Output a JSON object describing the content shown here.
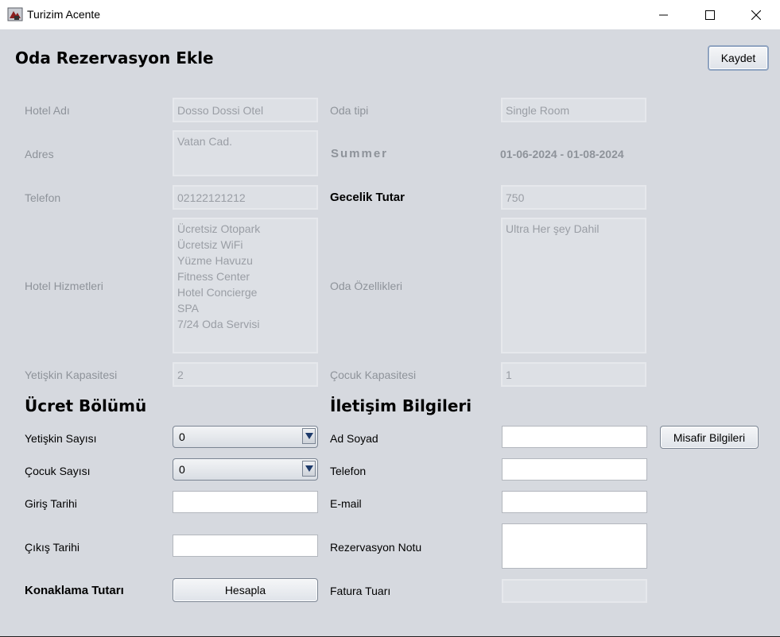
{
  "window": {
    "title": "Turizim Acente",
    "controls": {
      "minimize": "minimize-icon",
      "maximize": "maximize-icon",
      "close": "close-icon"
    }
  },
  "page": {
    "title": "Oda Rezervasyon Ekle",
    "save_label": "Kaydet"
  },
  "hotel": {
    "name_label": "Hotel Adı",
    "name_value": "Dosso Dossi Otel",
    "address_label": "Adres",
    "address_value": "Vatan Cad.",
    "phone_label": "Telefon",
    "phone_value": "02122121212",
    "services_label": "Hotel Hizmetleri",
    "services": [
      "Ücretsiz Otopark",
      "Ücretsiz WiFi",
      "Yüzme Havuzu",
      "Fitness Center",
      "Hotel Concierge",
      "SPA",
      "7/24 Oda Servisi"
    ],
    "adult_capacity_label": "Yetişkin Kapasitesi",
    "adult_capacity_value": "2"
  },
  "room": {
    "type_label": "Oda tipi",
    "type_value": "Single Room",
    "season_label": "Summer",
    "season_dates": "01-06-2024 - 01-08-2024",
    "nightly_label": "Gecelik Tutar",
    "nightly_value": "750",
    "features_label": "Oda Özellikleri",
    "features_value": "Ultra Her şey Dahil",
    "child_capacity_label": "Çocuk Kapasitesi",
    "child_capacity_value": "1"
  },
  "pricing": {
    "section_title": "Ücret Bölümü",
    "adult_count_label": "Yetişkin Sayısı",
    "adult_count_value": "0",
    "child_count_label": "Çocuk Sayısı",
    "child_count_value": "0",
    "checkin_label": "Giriş Tarihi",
    "checkin_value": "",
    "checkout_label": "Çıkış Tarihi",
    "checkout_value": "",
    "stay_total_label": "Konaklama Tutarı",
    "calculate_label": "Hesapla"
  },
  "contact": {
    "section_title": "İletişim Bilgileri",
    "name_label": "Ad Soyad",
    "name_value": "",
    "guest_info_label": "Misafir Bilgileri",
    "phone_label": "Telefon",
    "phone_value": "",
    "email_label": "E-mail",
    "email_value": "",
    "note_label": "Rezervasyon Notu",
    "note_value": "",
    "invoice_label": "Fatura Tuarı",
    "invoice_value": ""
  }
}
